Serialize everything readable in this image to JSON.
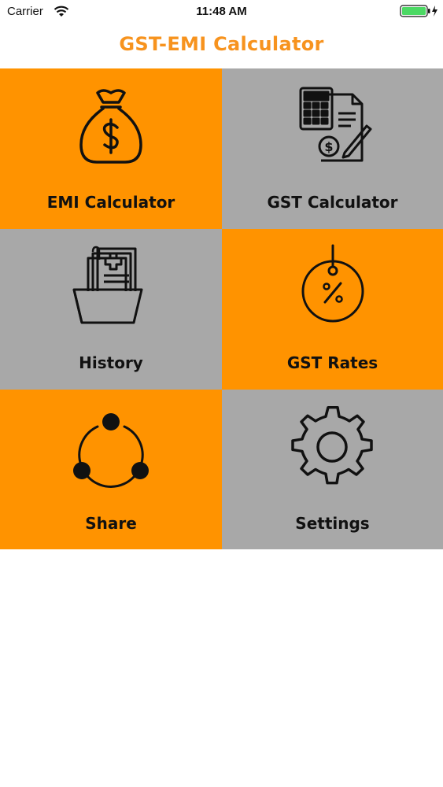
{
  "status_bar": {
    "carrier": "Carrier",
    "time": "11:48 AM",
    "battery_color": "#4CD964"
  },
  "nav": {
    "title": "GST-EMI Calculator",
    "title_color": "#F7931E"
  },
  "colors": {
    "orange": "#FF9300",
    "gray": "#A8A8A8"
  },
  "tiles": [
    {
      "label": "EMI Calculator",
      "icon": "money-bag-icon",
      "color": "orange"
    },
    {
      "label": "GST Calculator",
      "icon": "calculator-invoice-icon",
      "color": "gray"
    },
    {
      "label": "History",
      "icon": "folder-documents-icon",
      "color": "gray"
    },
    {
      "label": "GST Rates",
      "icon": "percent-tag-icon",
      "color": "orange"
    },
    {
      "label": "Share",
      "icon": "share-icon",
      "color": "orange"
    },
    {
      "label": "Settings",
      "icon": "gear-icon",
      "color": "gray"
    }
  ]
}
